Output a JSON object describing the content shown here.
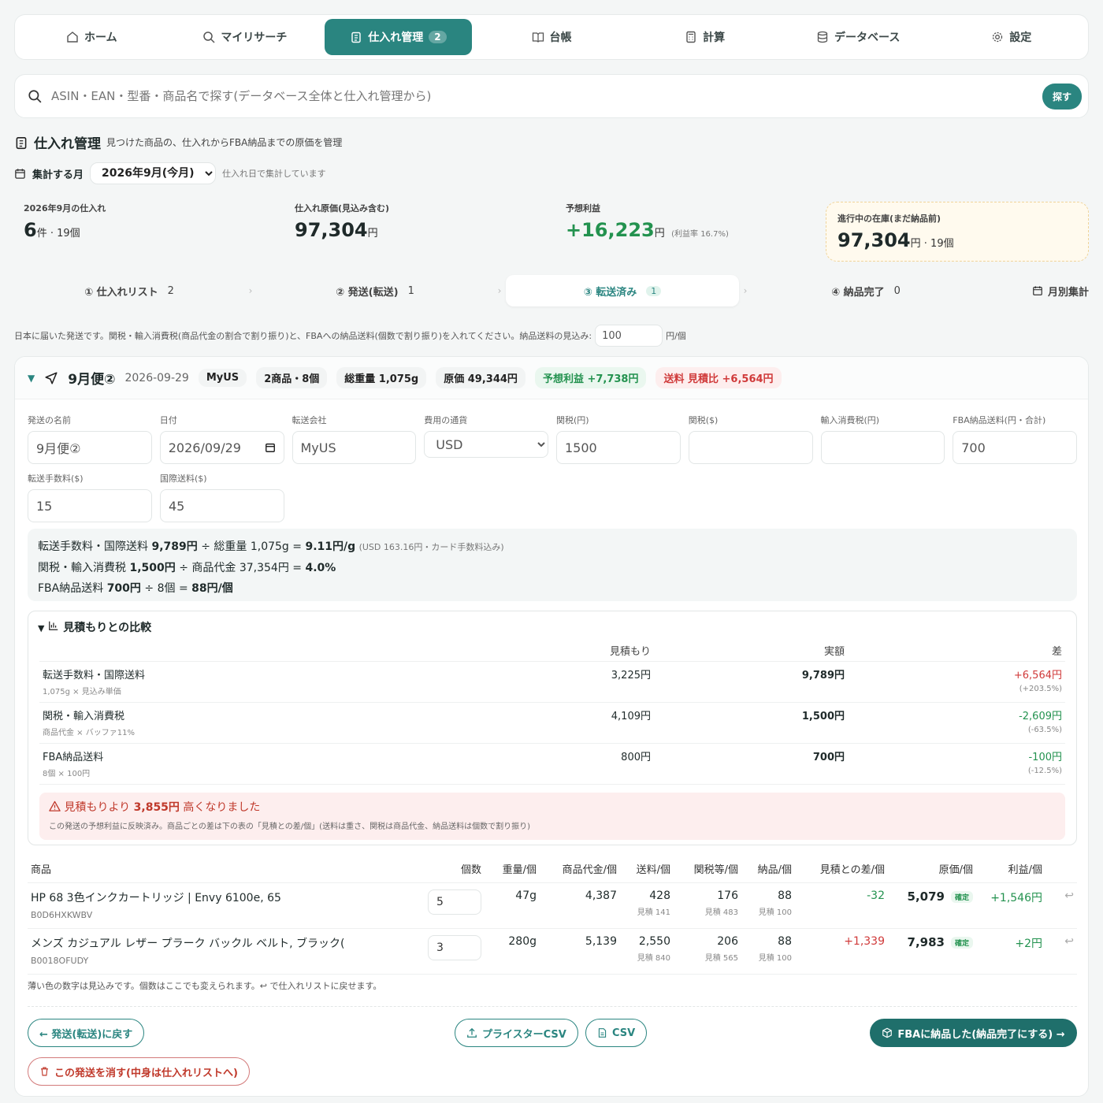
{
  "nav": {
    "tabs": [
      {
        "label": "ホーム",
        "icon": "home-icon"
      },
      {
        "label": "マイリサーチ",
        "icon": "search-icon"
      },
      {
        "label": "仕入れ管理",
        "icon": "clipboard-icon",
        "badge": "2"
      },
      {
        "label": "台帳",
        "icon": "book-icon"
      },
      {
        "label": "計算",
        "icon": "calculator-icon"
      },
      {
        "label": "データベース",
        "icon": "database-icon"
      },
      {
        "label": "設定",
        "icon": "gear-icon"
      }
    ],
    "active_color": "#2a8580"
  },
  "search": {
    "placeholder": "ASIN・EAN・型番・商品名で探す(データベース全体と仕入れ管理から)",
    "button": "探す"
  },
  "page": {
    "title": "仕入れ管理",
    "subtitle": "見つけた商品の、仕入れからFBA納品までの原価を管理"
  },
  "month": {
    "label": "集計する月",
    "selected": "2026年9月(今月)",
    "note": "仕入れ日で集計しています"
  },
  "kpis": {
    "purchases": {
      "label": "2026年9月の仕入れ",
      "count": "6",
      "count_unit": "件",
      "pieces": "19個"
    },
    "cost": {
      "label": "仕入れ原価(見込み含む)",
      "value": "97,304",
      "unit": "円"
    },
    "profit": {
      "label": "予想利益",
      "value": "+16,223",
      "unit": "円",
      "rate": "(利益率 16.7%)"
    },
    "inventory": {
      "label": "進行中の在庫(まだ納品前)",
      "value": "97,304",
      "unit": "円",
      "pieces": "19個"
    }
  },
  "steps": [
    {
      "label": "① 仕入れリスト",
      "count": "2"
    },
    {
      "label": "② 発送(転送)",
      "count": "1"
    },
    {
      "label": "③ 転送済み",
      "count": "1"
    },
    {
      "label": "④ 納品完了",
      "count": "0"
    }
  ],
  "monthly_label": "月別集計",
  "info": {
    "text": "日本に届いた発送です。関税・輸入消費税(商品代金の割合で割り振り)と、FBAへの納品送料(個数で割り振り)を入れてください。納品送料の見込み:",
    "value": "100",
    "unit": "円/個"
  },
  "shipment": {
    "name": "9月便②",
    "date": "2026-09-29",
    "carrier": "MyUS",
    "items_chip": "2商品・8個",
    "weight_chip": "総重量 1,075g",
    "cost_chip": "原価 49,344円",
    "profit_chip": "予想利益 +7,738円",
    "shipping_chip": "送料 見積比 +6,564円"
  },
  "form": {
    "name": {
      "label": "発送の名前",
      "value": "9月便②"
    },
    "date": {
      "label": "日付",
      "value": "2026/09/29"
    },
    "carrier": {
      "label": "転送会社",
      "value": "MyUS"
    },
    "currency": {
      "label": "費用の通貨",
      "value": "USD"
    },
    "duty_jpy": {
      "label": "関税(円)",
      "value": "1500"
    },
    "duty_usd": {
      "label": "関税($)",
      "value": ""
    },
    "import_tax": {
      "label": "輸入消費税(円)",
      "value": ""
    },
    "fba_fee": {
      "label": "FBA納品送料(円・合計)",
      "value": "700"
    },
    "fwd_fee": {
      "label": "転送手数料($)",
      "value": "15"
    },
    "intl_fee": {
      "label": "国際送料($)",
      "value": "45"
    }
  },
  "calc": {
    "line1": {
      "a": "転送手数料・国際送料",
      "b": "9,789円",
      "c": "÷ 総重量",
      "d": "1,075g",
      "e": "=",
      "f": "9.11円/g",
      "g": "(USD 163.16円・カード手数料込み)"
    },
    "line2": {
      "a": "関税・輸入消費税",
      "b": "1,500円",
      "c": "÷ 商品代金",
      "d": "37,354円",
      "e": "=",
      "f": "4.0%"
    },
    "line3": {
      "a": "FBA納品送料",
      "b": "700円",
      "c": "÷",
      "d": "8個",
      "e": "=",
      "f": "88円/個"
    }
  },
  "comparison": {
    "title": "見積もりとの比較",
    "headers": [
      "",
      "見積もり",
      "実額",
      "差"
    ],
    "rows": [
      {
        "name": "転送手数料・国際送料",
        "sub": "1,075g × 見込み単価",
        "estimate": "3,225円",
        "actual": "9,789円",
        "diff": "+6,564円",
        "pct": "(+203.5%)",
        "dir": "pos"
      },
      {
        "name": "関税・輸入消費税",
        "sub": "商品代金 × バッファ11%",
        "estimate": "4,109円",
        "actual": "1,500円",
        "diff": "-2,609円",
        "pct": "(-63.5%)",
        "dir": "neg"
      },
      {
        "name": "FBA納品送料",
        "sub": "8個 × 100円",
        "estimate": "800円",
        "actual": "700円",
        "diff": "-100円",
        "pct": "(-12.5%)",
        "dir": "neg"
      }
    ],
    "alert_a": "見積もりより",
    "alert_b": "3,855円",
    "alert_c": "高くなりました",
    "alert_detail": "この発送の予想利益に反映済み。商品ごとの差は下の表の「見積との差/個」(送料は重さ、関税は商品代金、納品送料は個数で割り振り)"
  },
  "items": {
    "headers": [
      "商品",
      "個数",
      "重量/個",
      "商品代金/個",
      "送料/個",
      "関税等/個",
      "納品/個",
      "見積との差/個",
      "原価/個",
      "利益/個"
    ],
    "rows": [
      {
        "name": "HP 68 3色インクカートリッジ | Envy 6100e, 65",
        "code": "B0D6HXKWBV",
        "qty": "5",
        "weight": "47g",
        "price": "4,387",
        "ship": "428",
        "ship_est": "見積 141",
        "duty": "176",
        "duty_est": "見積 483",
        "fba": "88",
        "fba_est": "見積 100",
        "diff": "-32",
        "dir": "neg",
        "cost": "5,079",
        "status": "確定",
        "profit": "+1,546円"
      },
      {
        "name": "メンズ カジュアル レザー プラーク バックル ベルト, ブラック(",
        "code": "B0018OFUDY",
        "qty": "3",
        "weight": "280g",
        "price": "5,139",
        "ship": "2,550",
        "ship_est": "見積 840",
        "duty": "206",
        "duty_est": "見積 565",
        "fba": "88",
        "fba_est": "見積 100",
        "diff": "+1,339",
        "dir": "pos",
        "cost": "7,983",
        "status": "確定",
        "profit": "+2円"
      }
    ],
    "note": "薄い色の数字は見込みです。個数はここでも変えられます。↩ で仕入れリストに戻せます。"
  },
  "actions": {
    "back": "← 発送(転送)に戻す",
    "pricester": "プライスターCSV",
    "csv": "CSV",
    "deliver": "FBAに納品した(納品完了にする) →",
    "delete": "この発送を消す(中身は仕入れリストへ)"
  }
}
